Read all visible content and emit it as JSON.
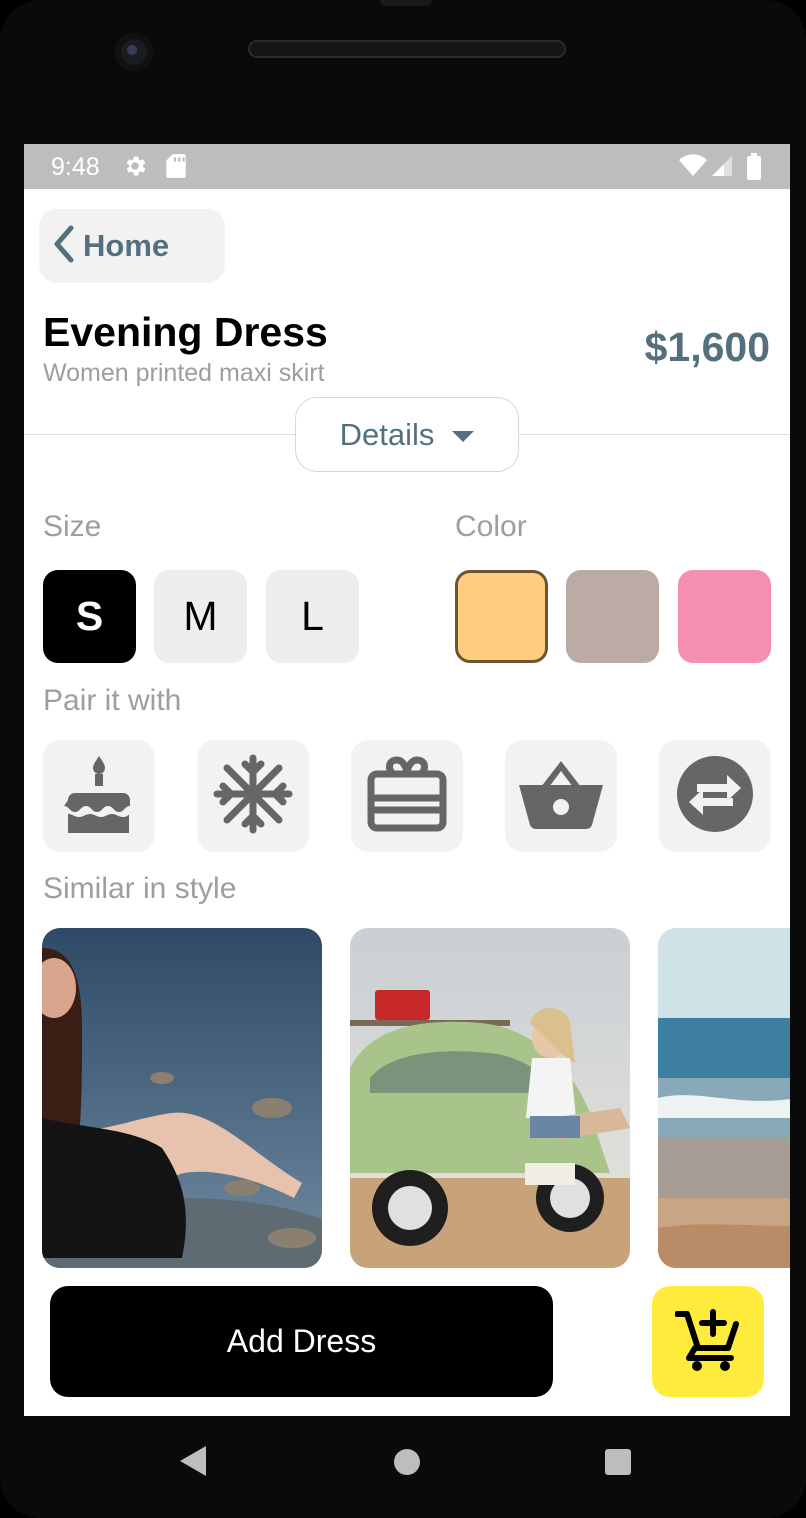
{
  "status_bar": {
    "time": "9:48"
  },
  "header": {
    "back_label": "Home"
  },
  "product": {
    "title": "Evening Dress",
    "subtitle": "Women printed maxi skirt",
    "price": "$1,600",
    "details_label": "Details"
  },
  "size": {
    "label": "Size",
    "options": [
      "S",
      "M",
      "L"
    ],
    "selected": "S"
  },
  "color": {
    "label": "Color",
    "options": [
      "#ffcc80",
      "#bcaaa4",
      "#f48fb1"
    ],
    "selected": "#ffcc80"
  },
  "pair": {
    "label": "Pair it with",
    "icons": [
      "cake-icon",
      "snowflake-icon",
      "gift-card-icon",
      "basket-icon",
      "swap-icon"
    ]
  },
  "similar": {
    "label": "Similar in style",
    "photos": [
      "photo-woman-seaside-rocks",
      "photo-woman-green-beetle-car",
      "photo-beach-waves"
    ]
  },
  "actions": {
    "add_label": "Add Dress",
    "cart_icon": "add-cart-icon"
  },
  "colors": {
    "accent": "#54707f",
    "cart_button": "#ffeb3b",
    "status_bar": "#bdbdbd"
  }
}
